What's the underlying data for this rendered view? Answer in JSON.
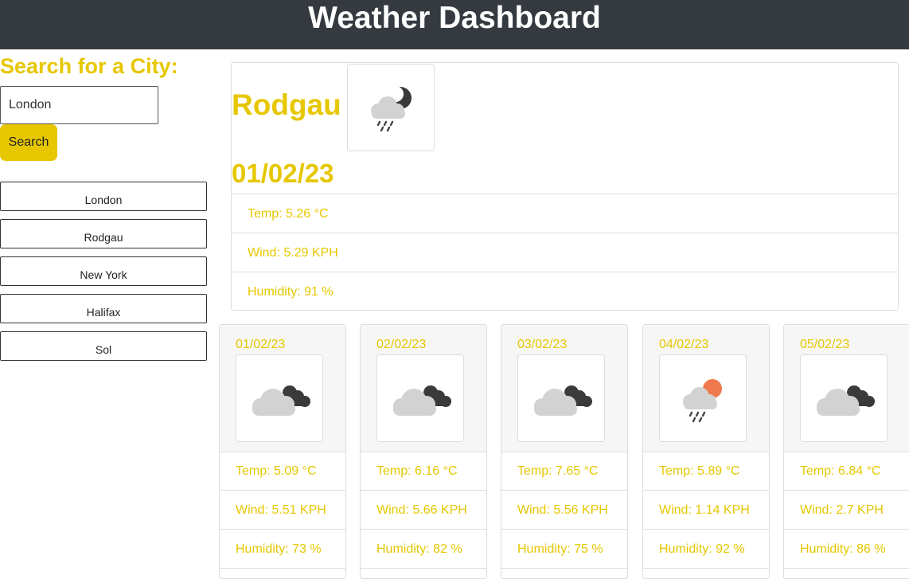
{
  "header": {
    "title": "Weather Dashboard"
  },
  "search": {
    "heading": "Search for a City:",
    "value": "London",
    "button_label": "Search"
  },
  "history": [
    "London",
    "Rodgau",
    "New York",
    "Halifax",
    "Sol"
  ],
  "current": {
    "city": "Rodgau",
    "date": "01/02/23",
    "icon": "cloud-rain-moon-icon",
    "temp": "Temp: 5.26 °C",
    "wind": "Wind: 5.29 KPH",
    "humidity": "Humidity: 91 %"
  },
  "forecast": [
    {
      "date": "01/02/23",
      "icon": "cloud-moon-icon",
      "temp": "Temp: 5.09 °C",
      "wind": "Wind: 5.51 KPH",
      "humidity": "Humidity: 73 %"
    },
    {
      "date": "02/02/23",
      "icon": "cloud-moon-icon",
      "temp": "Temp: 6.16 °C",
      "wind": "Wind: 5.66 KPH",
      "humidity": "Humidity: 82 %"
    },
    {
      "date": "03/02/23",
      "icon": "cloud-moon-icon",
      "temp": "Temp: 7.65 °C",
      "wind": "Wind: 5.56 KPH",
      "humidity": "Humidity: 75 %"
    },
    {
      "date": "04/02/23",
      "icon": "cloud-rain-sun-icon",
      "temp": "Temp: 5.89 °C",
      "wind": "Wind: 1.14 KPH",
      "humidity": "Humidity: 92 %"
    },
    {
      "date": "05/02/23",
      "icon": "cloud-moon-icon",
      "temp": "Temp: 6.84 °C",
      "wind": "Wind: 2.7 KPH",
      "humidity": "Humidity: 86 %"
    }
  ]
}
